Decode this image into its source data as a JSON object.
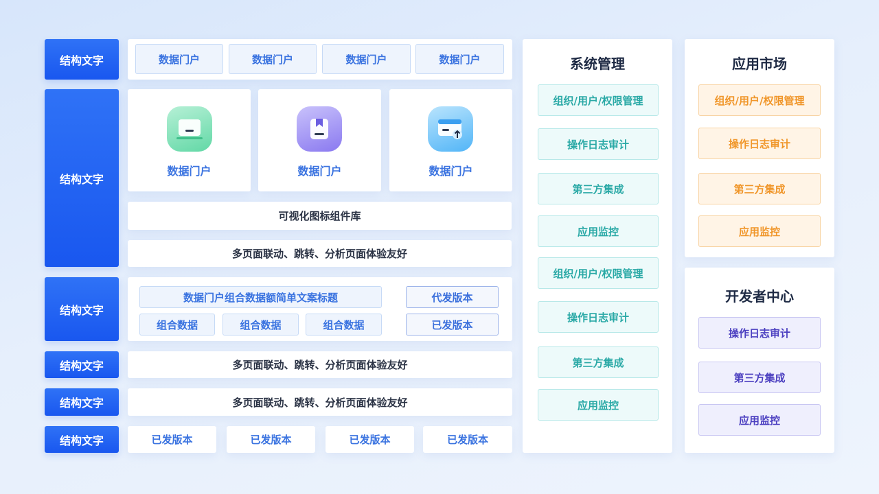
{
  "row_labels": [
    "结构文字",
    "结构文字",
    "结构文字",
    "结构文字",
    "结构文字",
    "结构文字"
  ],
  "top_tabs": [
    "数据门户",
    "数据门户",
    "数据门户",
    "数据门户"
  ],
  "portal_cards": [
    {
      "icon": "monitor-icon",
      "color": "#4fcf9a",
      "label": "数据门户"
    },
    {
      "icon": "bookmark-box-icon",
      "color": "#7c6cf0",
      "label": "数据门户"
    },
    {
      "icon": "card-upload-icon",
      "color": "#3aa6f5",
      "label": "数据门户"
    }
  ],
  "visual_library": "可视化图标组件库",
  "multi_page_1": "多页面联动、跳转、分析页面体验友好",
  "combo": {
    "title": "数据门户组合数据额简单文案标题",
    "items": [
      "组合数据",
      "组合数据",
      "组合数据"
    ],
    "pending_version": "代发版本",
    "released_version": "已发版本"
  },
  "multi_page_2": "多页面联动、跳转、分析页面体验友好",
  "multi_page_3": "多页面联动、跳转、分析页面体验友好",
  "versions": [
    "已发版本",
    "已发版本",
    "已发版本",
    "已发版本"
  ],
  "system_mgmt": {
    "title": "系统管理",
    "items": [
      "组织/用户/权限管理",
      "操作日志审计",
      "第三方集成",
      "应用监控",
      "组织/用户/权限管理",
      "操作日志审计",
      "第三方集成",
      "应用监控"
    ]
  },
  "app_market": {
    "title": "应用市场",
    "items": [
      "组织/用户/权限管理",
      "操作日志审计",
      "第三方集成",
      "应用监控"
    ]
  },
  "dev_center": {
    "title": "开发者中心",
    "items": [
      "操作日志审计",
      "第三方集成",
      "应用监控"
    ]
  },
  "colors": {
    "label_blue": "#1f5ff2",
    "accent_blue": "#3a73e0",
    "teal": "#2aa9a6",
    "orange": "#f0962a",
    "purple": "#4b3fc0"
  }
}
